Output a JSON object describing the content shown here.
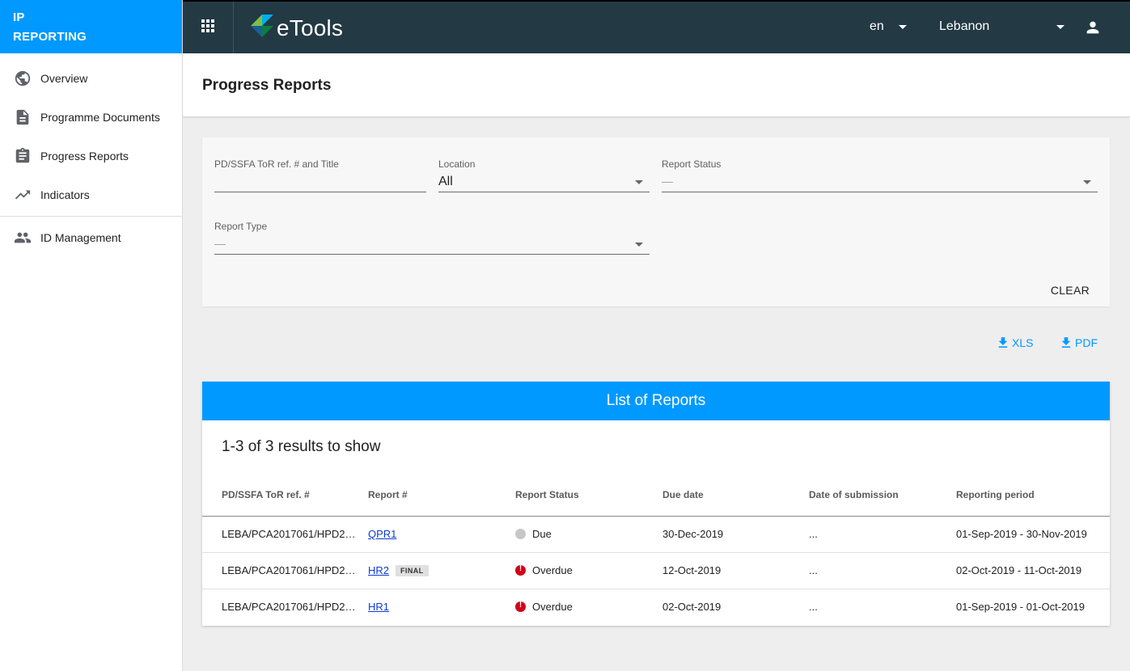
{
  "brand": {
    "line1": "IP",
    "line2": "REPORTING",
    "color": "#0099ff"
  },
  "sidebar": {
    "items": [
      {
        "label": "Overview",
        "icon": "globe-icon"
      },
      {
        "label": "Programme Documents",
        "icon": "document-icon"
      },
      {
        "label": "Progress Reports",
        "icon": "clipboard-icon"
      },
      {
        "label": "Indicators",
        "icon": "trending-up-icon"
      },
      {
        "label": "ID Management",
        "icon": "people-icon"
      }
    ]
  },
  "topbar": {
    "app_name": "eTools",
    "language": "en",
    "country": "Lebanon",
    "background": "#233944"
  },
  "page": {
    "title": "Progress Reports"
  },
  "filters": {
    "ref_title": {
      "label": "PD/SSFA ToR ref. # and Title",
      "value": ""
    },
    "location": {
      "label": "Location",
      "value": "All"
    },
    "report_status": {
      "label": "Report Status",
      "value": "—"
    },
    "report_type": {
      "label": "Report Type",
      "value": "—"
    },
    "clear_label": "CLEAR"
  },
  "export": {
    "xls_label": "XLS",
    "pdf_label": "PDF"
  },
  "reports": {
    "heading": "List of Reports",
    "results_text": "1-3 of 3 results to show",
    "columns": [
      "PD/SSFA ToR ref. #",
      "Report #",
      "Report Status",
      "Due date",
      "Date of submission",
      "Reporting period"
    ],
    "rows": [
      {
        "ref": "LEBA/PCA2017061/HPD2…",
        "report": "QPR1",
        "badge": "",
        "status": "Due",
        "status_type": "due",
        "due_date": "30-Dec-2019",
        "submission": "...",
        "period": "01-Sep-2019 - 30-Nov-2019"
      },
      {
        "ref": "LEBA/PCA2017061/HPD2…",
        "report": "HR2",
        "badge": "FINAL",
        "status": "Overdue",
        "status_type": "overdue",
        "due_date": "12-Oct-2019",
        "submission": "...",
        "period": "02-Oct-2019 - 11-Oct-2019"
      },
      {
        "ref": "LEBA/PCA2017061/HPD2…",
        "report": "HR1",
        "badge": "",
        "status": "Overdue",
        "status_type": "overdue",
        "due_date": "02-Oct-2019",
        "submission": "...",
        "period": "01-Sep-2019 - 01-Oct-2019"
      }
    ]
  }
}
